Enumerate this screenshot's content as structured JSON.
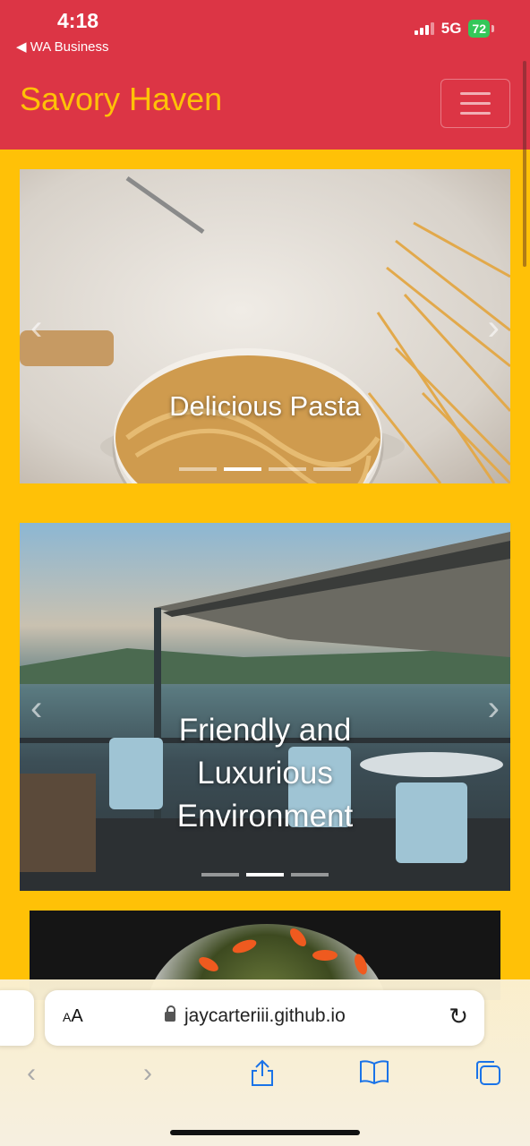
{
  "status": {
    "time": "4:18",
    "back_app": "◀ WA Business",
    "network": "5G",
    "battery": "72"
  },
  "navbar": {
    "brand": "Savory Haven"
  },
  "carousels": [
    {
      "caption": "Delicious Pasta",
      "indicator_count": 4,
      "active_index": 1
    },
    {
      "caption": "Friendly and Luxurious Environment",
      "indicator_count": 3,
      "active_index": 1
    }
  ],
  "safari": {
    "text_size": "AA",
    "url": "jaycarteriii.github.io"
  },
  "icons": {
    "prev": "chevron-left-icon",
    "next": "chevron-right-icon",
    "menu": "hamburger-icon",
    "lock": "lock-icon",
    "reload": "reload-icon",
    "share": "share-icon",
    "bookmarks": "book-icon",
    "tabs": "tabs-icon"
  },
  "colors": {
    "navbar": "#dc3545",
    "page": "#ffc107",
    "brand": "#ffc107",
    "safari_accent": "#1a73e8"
  }
}
